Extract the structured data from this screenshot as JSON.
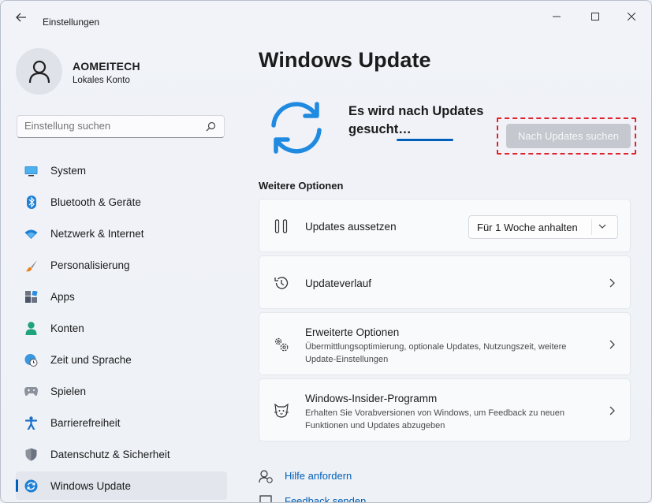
{
  "app": {
    "title": "Einstellungen"
  },
  "user": {
    "name": "AOMEITECH",
    "account_type": "Lokales Konto"
  },
  "search": {
    "placeholder": "Einstellung suchen"
  },
  "sidebar": {
    "items": [
      {
        "label": "System",
        "icon": "monitor-icon"
      },
      {
        "label": "Bluetooth & Geräte",
        "icon": "bluetooth-icon"
      },
      {
        "label": "Netzwerk & Internet",
        "icon": "wifi-icon"
      },
      {
        "label": "Personalisierung",
        "icon": "brush-icon"
      },
      {
        "label": "Apps",
        "icon": "apps-icon"
      },
      {
        "label": "Konten",
        "icon": "person-icon"
      },
      {
        "label": "Zeit und Sprache",
        "icon": "globe-clock-icon"
      },
      {
        "label": "Spielen",
        "icon": "gamepad-icon"
      },
      {
        "label": "Barrierefreiheit",
        "icon": "accessibility-icon"
      },
      {
        "label": "Datenschutz & Sicherheit",
        "icon": "shield-icon"
      },
      {
        "label": "Windows Update",
        "icon": "sync-icon",
        "active": true
      }
    ]
  },
  "main": {
    "title": "Windows Update",
    "status": "Es wird nach Updates gesucht…",
    "check_button": "Nach Updates suchen",
    "section_title": "Weitere Optionen",
    "cards": {
      "pause": {
        "title": "Updates aussetzen",
        "dropdown_value": "Für 1 Woche anhalten",
        "icon": "pause-icon"
      },
      "history": {
        "title": "Updateverlauf",
        "icon": "history-icon"
      },
      "advanced": {
        "title": "Erweiterte Optionen",
        "desc": "Übermittlungsoptimierung, optionale Updates, Nutzungszeit, weitere Update-Einstellungen",
        "icon": "gears-icon"
      },
      "insider": {
        "title": "Windows-Insider-Programm",
        "desc": "Erhalten Sie Vorabversionen von Windows, um Feedback zu neuen Funktionen und Updates abzugeben",
        "icon": "insider-cat-icon"
      }
    },
    "links": {
      "help": "Hilfe anfordern",
      "feedback": "Feedback senden"
    }
  },
  "colors": {
    "accent": "#005fb8",
    "highlight_frame": "#e0242c",
    "sync_icon": "#1f8ae0"
  }
}
